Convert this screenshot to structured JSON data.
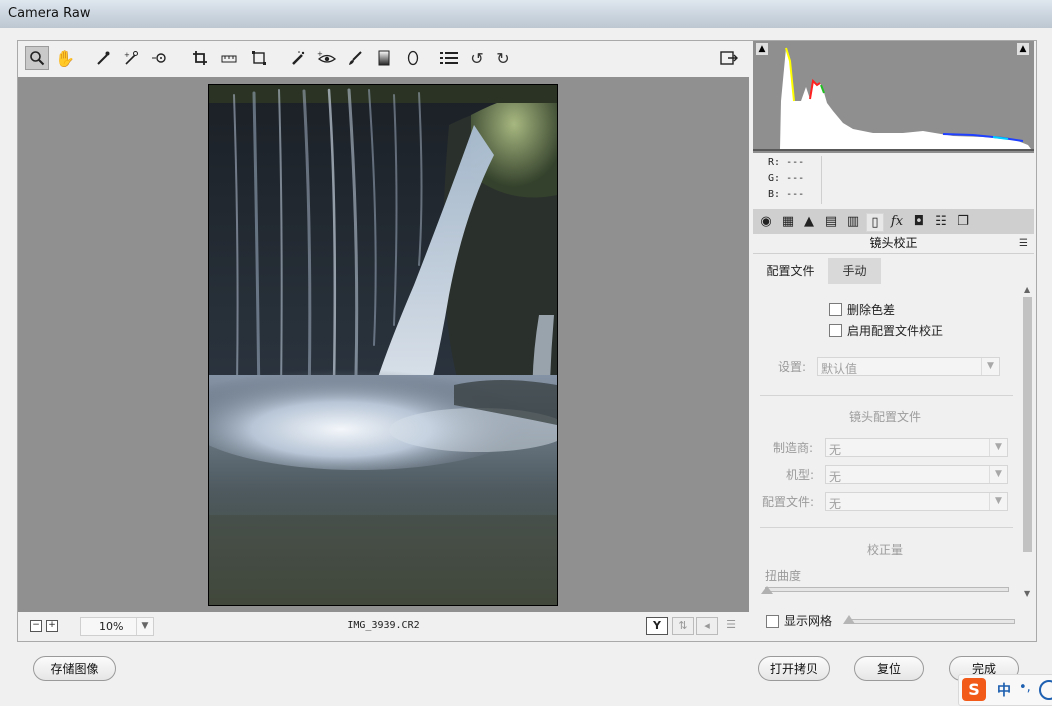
{
  "window": {
    "title": "Camera Raw"
  },
  "toolbar": {
    "icons": [
      "zoom-tool-icon",
      "hand-tool-icon",
      "white-balance-icon",
      "color-sampler-icon",
      "target-adjust-icon",
      "crop-icon",
      "straighten-icon",
      "transform-icon",
      "spot-removal-icon",
      "red-eye-icon",
      "adjustment-brush-icon",
      "graduated-filter-icon",
      "radial-filter-icon",
      "preferences-icon",
      "rotate-ccw-icon",
      "rotate-cw-icon"
    ]
  },
  "status": {
    "zoom": "10%",
    "filename": "IMG_3939.CR2",
    "view_mode": "Y"
  },
  "histogram": {
    "r_label": "R:",
    "r_value": "---",
    "g_label": "G:",
    "g_value": "---",
    "b_label": "B:",
    "b_value": "---"
  },
  "panel": {
    "title": "镜头校正",
    "tabs": [
      "配置文件",
      "手动"
    ],
    "active_tab": "配置文件",
    "remove_ca_label": "删除色差",
    "enable_profile_label": "启用配置文件校正",
    "setup_label": "设置:",
    "setup_value": "默认值",
    "lens_profile_heading": "镜头配置文件",
    "make_label": "制造商:",
    "make_value": "无",
    "model_label": "机型:",
    "model_value": "无",
    "profile_label": "配置文件:",
    "profile_value": "无",
    "amount_heading": "校正量",
    "distortion_label": "扭曲度"
  },
  "grid": {
    "label": "显示网格"
  },
  "buttons": {
    "save": "存储图像",
    "open_copy": "打开拷贝",
    "reset": "复位",
    "done": "完成"
  },
  "ime": {
    "label": "中"
  }
}
